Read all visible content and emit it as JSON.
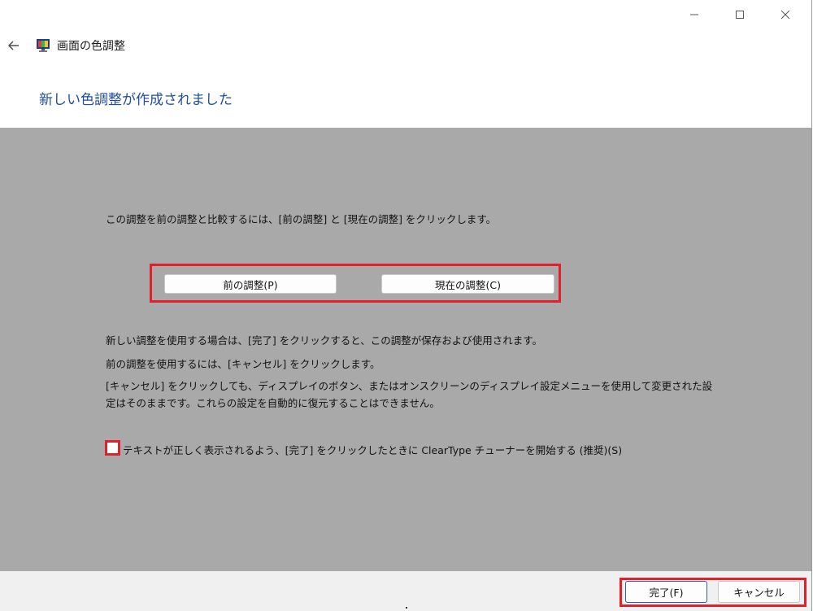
{
  "app": {
    "title": "画面の色調整"
  },
  "page": {
    "heading": "新しい色調整が作成されました"
  },
  "content": {
    "compare_text": "この調整を前の調整と比較するには、[前の調整] と [現在の調整] をクリックします。",
    "prev_button": "前の調整(P)",
    "current_button": "現在の調整(C)",
    "finish_info": "新しい調整を使用する場合は、[完了] をクリックすると、この調整が保存および使用されます。",
    "cancel_info": "前の調整を使用するには、[キャンセル] をクリックします。",
    "cancel_note_line1": "[キャンセル] をクリックしても、ディスプレイのボタン、またはオンスクリーンのディスプレイ設定メニューを使用して変更された設",
    "cancel_note_line2": "定はそのままです。これらの設定を自動的に復元することはできません。",
    "cleartype_label": "テキストが正しく表示されるよう、[完了] をクリックしたときに ClearType チューナーを開始する (推奨)(S)",
    "cleartype_checked": false
  },
  "footer": {
    "finish_button": "完了(F)",
    "cancel_button": "キャンセル"
  },
  "colors": {
    "heading": "#1f4e9c",
    "content_bg": "#a9a9a9",
    "highlight": "#e0202a"
  }
}
